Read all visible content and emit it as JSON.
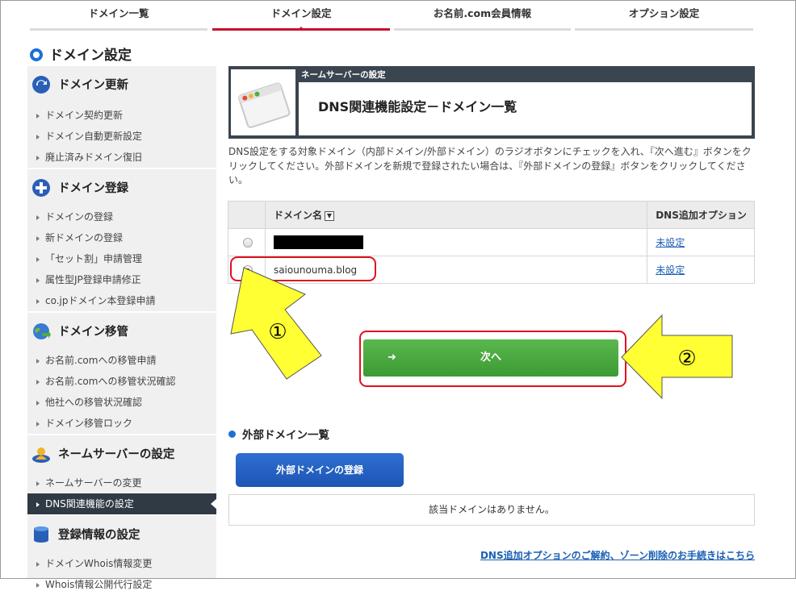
{
  "topnav": {
    "tabs": [
      {
        "label": "ドメイン一覧"
      },
      {
        "label": "ドメイン設定"
      },
      {
        "label": "お名前.com会員情報"
      },
      {
        "label": "オプション設定"
      }
    ]
  },
  "page_title": "ドメイン設定",
  "sidebar": {
    "sections": [
      {
        "title": "ドメイン更新",
        "items": [
          "ドメイン契約更新",
          "ドメイン自動更新設定",
          "廃止済みドメイン復旧"
        ]
      },
      {
        "title": "ドメイン登録",
        "items": [
          "ドメインの登録",
          "新ドメインの登録",
          "「セット割」申請管理",
          "属性型JP登録申請修正",
          "co.jpドメイン本登録申請"
        ]
      },
      {
        "title": "ドメイン移管",
        "items": [
          "お名前.comへの移管申請",
          "お名前.comへの移管状況確認",
          "他社への移管状況確認",
          "ドメイン移管ロック"
        ]
      },
      {
        "title": "ネームサーバーの設定",
        "items": [
          "ネームサーバーの変更",
          "DNS関連機能の設定"
        ]
      },
      {
        "title": "登録情報の設定",
        "items": [
          "ドメインWhois情報変更",
          "Whois情報公開代行設定"
        ]
      }
    ]
  },
  "header": {
    "subtitle": "ネームサーバーの設定",
    "title": "DNS関連機能設定－ドメイン一覧"
  },
  "description": "DNS設定をする対象ドメイン（内部ドメイン/外部ドメイン）のラジオボタンにチェックを入れ、『次へ進む』ボタンをクリックしてください。外部ドメインを新規で登録されたい場合は、『外部ドメインの登録』ボタンをクリックしてください。",
  "table": {
    "headers": [
      "",
      "ドメイン名",
      "DNS追加オプション"
    ],
    "sort_icon": "▼",
    "rows": [
      {
        "selected": false,
        "domain": "",
        "option": "未設定"
      },
      {
        "selected": true,
        "domain": "saiounouma.blog",
        "option": "未設定"
      }
    ]
  },
  "next_button": {
    "arrow": "➜",
    "label": "次へ"
  },
  "annotations": {
    "one": "①",
    "two": "②"
  },
  "external": {
    "title": "外部ドメイン一覧",
    "register_button": "外部ドメインの登録",
    "empty_text": "該当ドメインはありません。"
  },
  "footer_link": "DNS追加オプションのご解約、ゾーン削除のお手続きはこちら",
  "colors": {
    "accent_red": "#c8102e",
    "primary_blue": "#1d6fd6",
    "next_green": "#4caf3f",
    "annotation_yellow": "#ffff33",
    "annotation_red": "#e0101e"
  }
}
